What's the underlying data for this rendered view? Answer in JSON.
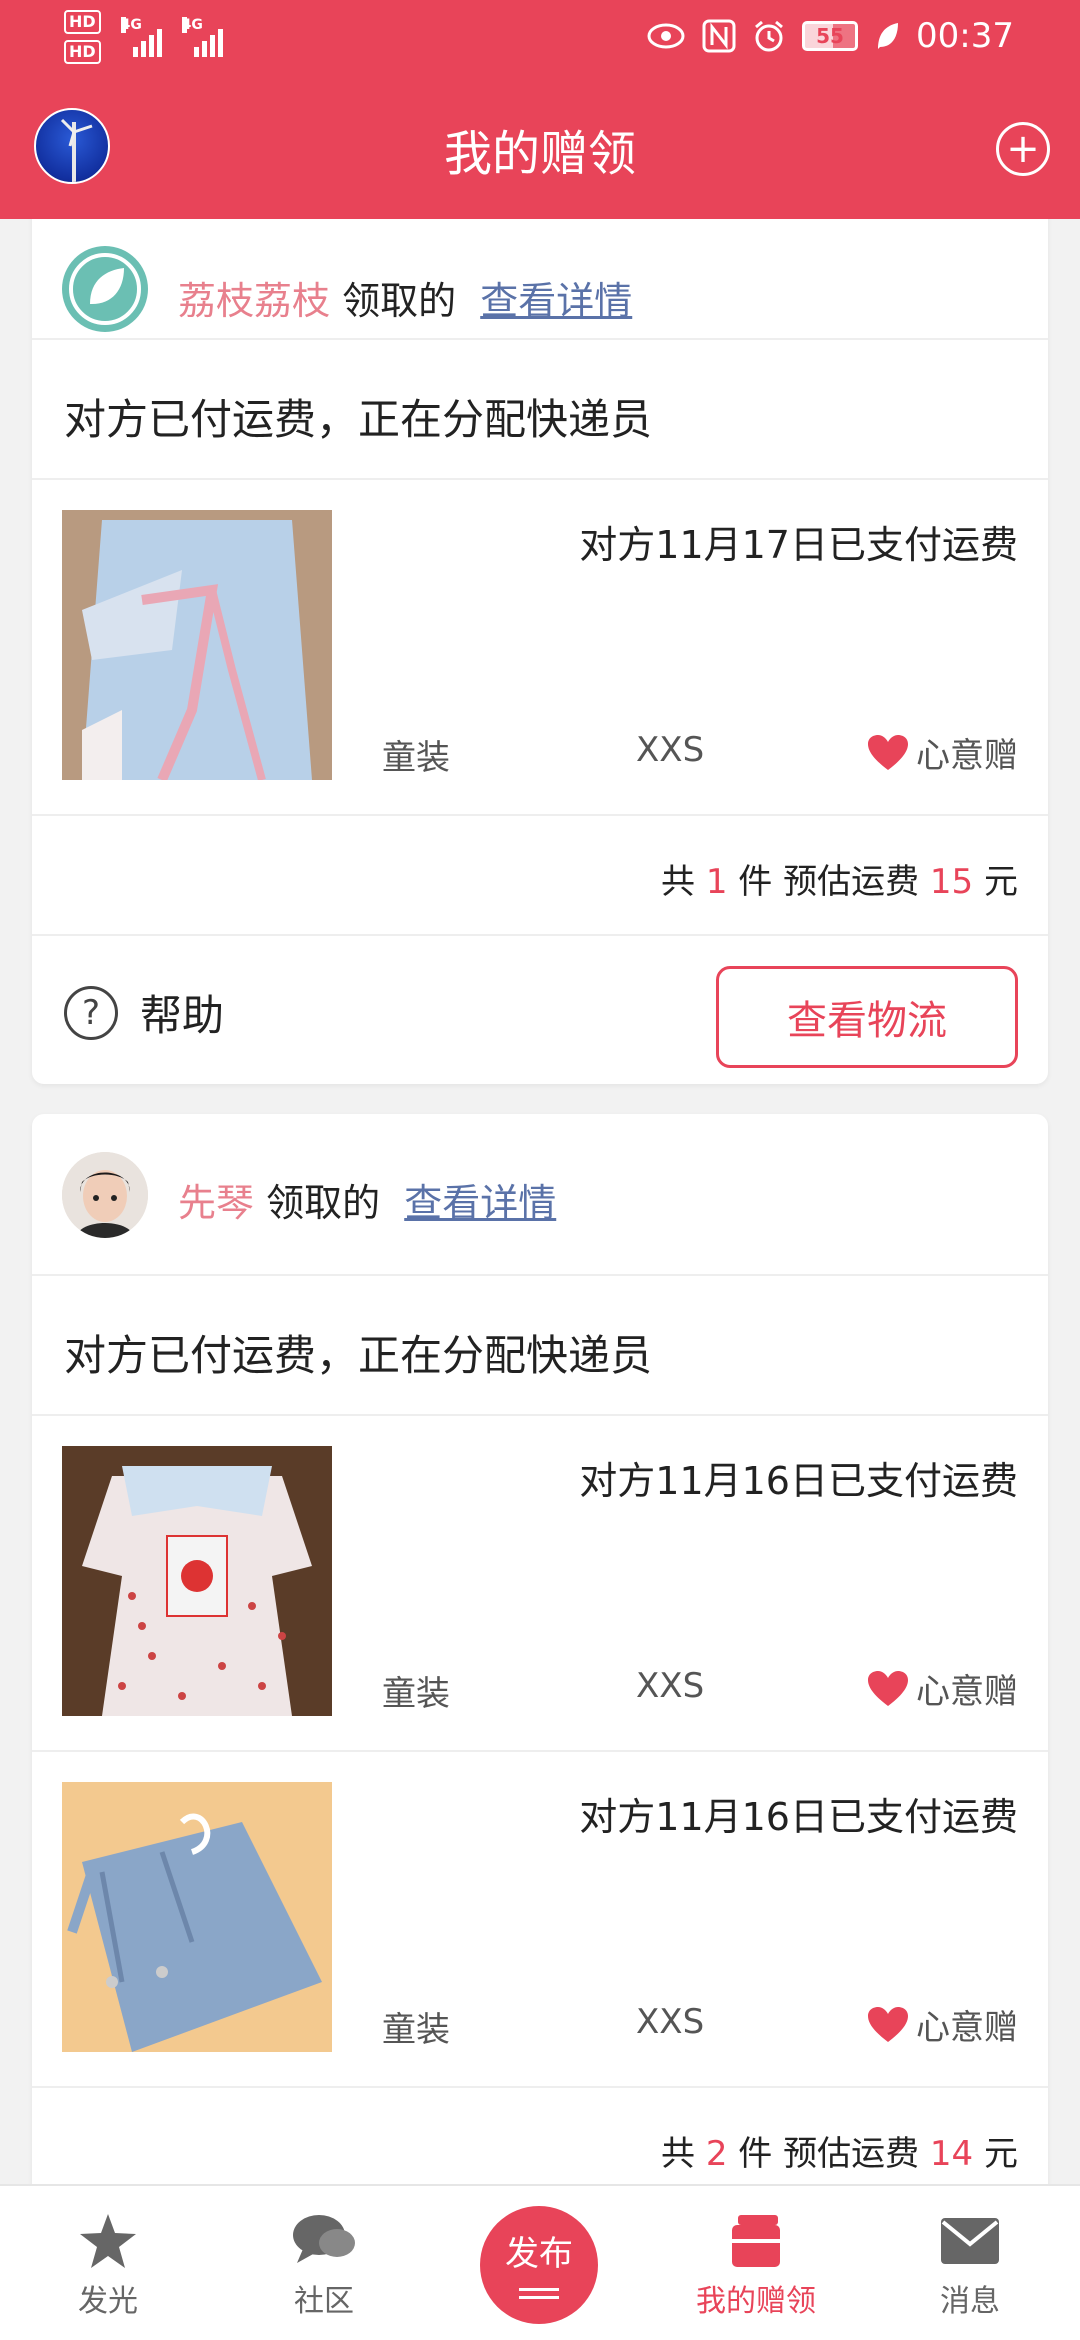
{
  "status_bar": {
    "hd1": "HD",
    "hd2": "HD",
    "net1": "4G",
    "net2": "4G",
    "battery": "55",
    "time": "00:37"
  },
  "header": {
    "title": "我的赠领",
    "plus": "+"
  },
  "cards": [
    {
      "giver_name": "荔枝荔枝",
      "action": "领取的",
      "detail_link": "查看详情",
      "status": "对方已付运费，正在分配快递员",
      "items": [
        {
          "paid": "对方11月17日已支付运费",
          "category": "童装",
          "size": "XXS",
          "tag": "心意赠"
        }
      ],
      "summary": {
        "prefix": "共",
        "count": "1",
        "mid": "件 预估运费",
        "fee": "15",
        "suffix": "元"
      },
      "help": "帮助",
      "logistics": "查看物流"
    },
    {
      "giver_name": "先琴",
      "action": "领取的",
      "detail_link": "查看详情",
      "status": "对方已付运费，正在分配快递员",
      "items": [
        {
          "paid": "对方11月16日已支付运费",
          "category": "童装",
          "size": "XXS",
          "tag": "心意赠"
        },
        {
          "paid": "对方11月16日已支付运费",
          "category": "童装",
          "size": "XXS",
          "tag": "心意赠"
        }
      ],
      "summary": {
        "prefix": "共",
        "count": "2",
        "mid": "件 预估运费",
        "fee": "14",
        "suffix": "元"
      }
    }
  ],
  "bottom_nav": {
    "items": [
      {
        "label": "发光",
        "icon": "star-icon"
      },
      {
        "label": "社区",
        "icon": "chat-bubbles-icon"
      },
      {
        "label": "发布",
        "icon": "publish-icon"
      },
      {
        "label": "我的赠领",
        "icon": "gift-box-icon",
        "active": true
      },
      {
        "label": "消息",
        "icon": "envelope-icon"
      }
    ]
  },
  "colors": {
    "brand": "#e84459",
    "name_pink": "#e8808d",
    "link": "#5a72a8"
  }
}
